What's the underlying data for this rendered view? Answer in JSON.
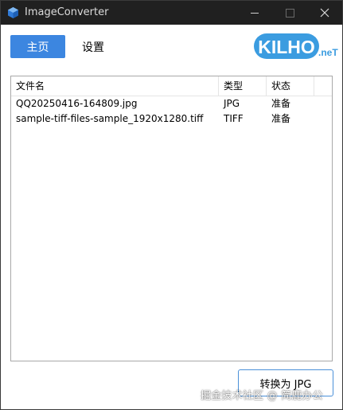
{
  "window": {
    "title": "ImageConverter"
  },
  "tabs": [
    {
      "label": "主页",
      "active": true
    },
    {
      "label": "设置",
      "active": false
    }
  ],
  "logo": {
    "text": "KILHO",
    "suffix": ".neT",
    "color": "#3b9ce0"
  },
  "list": {
    "columns": [
      "文件名",
      "类型",
      "状态"
    ],
    "rows": [
      {
        "name": "QQ20250416-164809.jpg",
        "type": "JPG",
        "status": "准备"
      },
      {
        "name": "sample-tiff-files-sample_1920x1280.tiff",
        "type": "TIFF",
        "status": "准备"
      }
    ]
  },
  "convert_button": {
    "label": "转换为 JPG"
  },
  "watermark": {
    "text": "掘金技术社区 @ 简鹿办公"
  },
  "colors": {
    "titlebar_bg": "#202020",
    "active_tab_bg": "#3c86e0",
    "button_border": "#4a90d9"
  }
}
